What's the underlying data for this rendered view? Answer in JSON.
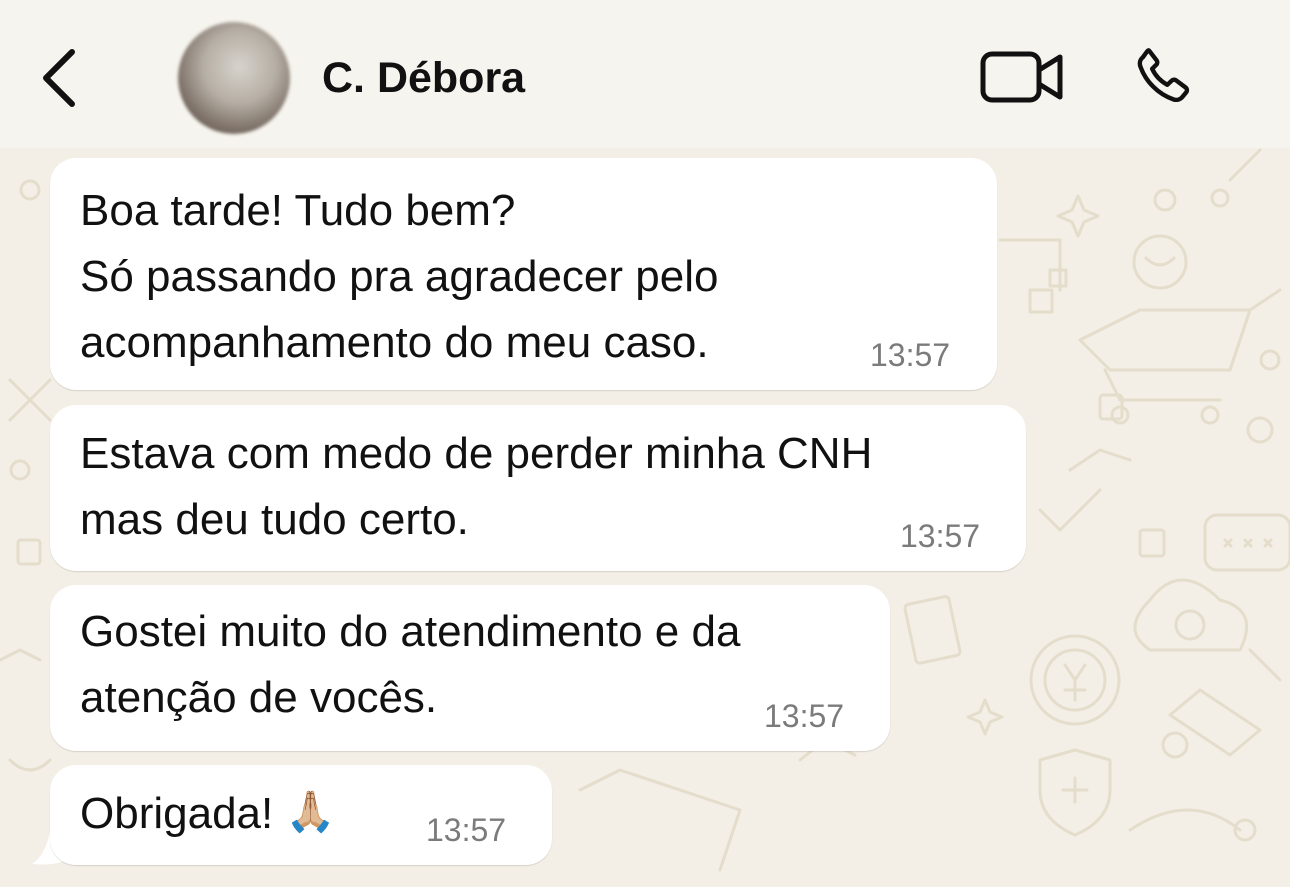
{
  "header": {
    "contact_name": "C. Débora",
    "back_icon": "chevron-left-icon",
    "video_icon": "video-call-icon",
    "phone_icon": "phone-call-icon"
  },
  "messages": [
    {
      "text": "Boa tarde! Tudo bem?\nSó passando pra agradecer pelo\nacompanhamento do meu caso.",
      "time": "13:57"
    },
    {
      "text": "Estava com medo de perder minha CNH\nmas deu tudo certo.",
      "time": "13:57"
    },
    {
      "text": "Gostei muito do atendimento e da\natenção de vocês.",
      "time": "13:57"
    },
    {
      "text": "Obrigada!",
      "emoji": "🙏🏼",
      "time": "13:57"
    }
  ],
  "colors": {
    "wallpaper": "#f3efe6",
    "bubble": "#ffffff",
    "time": "#7b7b7b"
  }
}
